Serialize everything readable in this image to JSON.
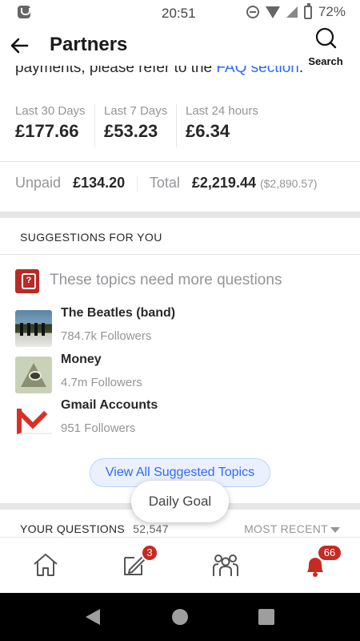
{
  "status_bar": {
    "time": "20:51",
    "battery": "72%"
  },
  "header": {
    "title": "Partners",
    "search_label": "Search"
  },
  "intro": {
    "text": "payments, please refer to the ",
    "link": "FAQ section",
    "suffix": "."
  },
  "earnings": [
    {
      "label": "Last 30 Days",
      "value": "£177.66"
    },
    {
      "label": "Last 7 Days",
      "value": "£53.23"
    },
    {
      "label": "Last 24 hours",
      "value": "£6.34"
    }
  ],
  "totals": {
    "unpaid_label": "Unpaid",
    "unpaid_value": "£134.20",
    "total_label": "Total",
    "total_value": "£2,219.44",
    "total_usd": "($2,890.57)"
  },
  "suggestions": {
    "heading": "SUGGESTIONS FOR YOU",
    "prompt": "These topics need more questions",
    "topics": [
      {
        "name": "The Beatles (band)",
        "followers": "784.7k Followers"
      },
      {
        "name": "Money",
        "followers": "4.7m Followers"
      },
      {
        "name": "Gmail Accounts",
        "followers": "951 Followers"
      }
    ],
    "view_all": "View All Suggested Topics"
  },
  "daily_goal": "Daily Goal",
  "your_questions": {
    "heading": "YOUR QUESTIONS",
    "count": "52,547",
    "sort": "MOST RECENT"
  },
  "bottom_nav": {
    "answer_badge": "3",
    "notifications_badge": "66"
  },
  "colors": {
    "brand_red": "#b92b27",
    "link_blue": "#2e69ff",
    "badge_red": "#c52a23"
  }
}
